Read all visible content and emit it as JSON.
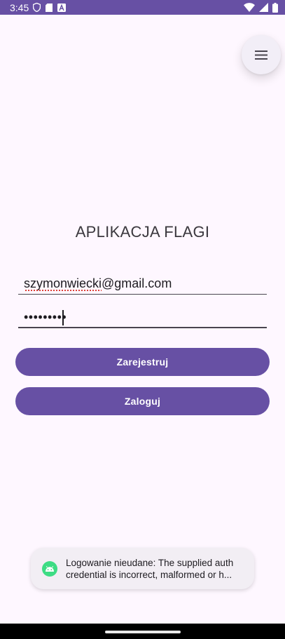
{
  "status_bar": {
    "time": "3:45",
    "left_icons": [
      "shield-icon",
      "sim-card-icon",
      "font-a-icon"
    ],
    "right_icons": [
      "wifi-icon",
      "signal-icon",
      "battery-icon"
    ],
    "background": "#6750a4"
  },
  "menu": {
    "icon": "hamburger-menu-icon"
  },
  "app": {
    "title": "APLIKACJA FLAGI"
  },
  "form": {
    "email_value": "szymonwiecki@gmail.com",
    "password_value": "•••••••••"
  },
  "buttons": {
    "register_label": "Zarejestruj",
    "login_label": "Zaloguj",
    "color": "#6750a4"
  },
  "toast": {
    "icon": "android-icon",
    "line1": "Logowanie nieudane: The supplied auth",
    "line2": "credential is incorrect, malformed or h..."
  }
}
